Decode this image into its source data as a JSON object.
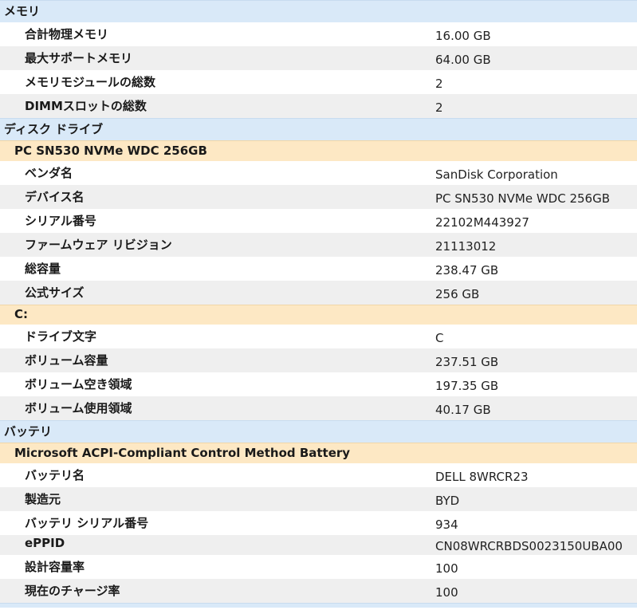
{
  "rows": [
    {
      "kind": "section",
      "label": "メモリ",
      "h": 28
    },
    {
      "kind": "item",
      "key": "合計物理メモリ",
      "value": "16.00 GB",
      "h": 30,
      "alt": false
    },
    {
      "kind": "item",
      "key": "最大サポートメモリ",
      "value": "64.00 GB",
      "h": 30,
      "alt": true
    },
    {
      "kind": "item",
      "key": "メモリモジュールの総数",
      "value": "2",
      "h": 30,
      "alt": false
    },
    {
      "kind": "item",
      "key": "DIMMスロットの総数",
      "value": "2",
      "h": 30,
      "alt": true
    },
    {
      "kind": "section",
      "label": "ディスク ドライブ",
      "h": 28
    },
    {
      "kind": "subsection",
      "label": "PC SN530 NVMe WDC 256GB",
      "h": 26
    },
    {
      "kind": "item",
      "key": "ベンダ名",
      "value": "SanDisk Corporation",
      "h": 30,
      "alt": false
    },
    {
      "kind": "item",
      "key": "デバイス名",
      "value": "PC SN530 NVMe WDC 256GB",
      "h": 30,
      "alt": true
    },
    {
      "kind": "item",
      "key": "シリアル番号",
      "value": "22102M443927",
      "h": 30,
      "alt": false
    },
    {
      "kind": "item",
      "key": "ファームウェア リビジョン",
      "value": "21113012",
      "h": 30,
      "alt": true
    },
    {
      "kind": "item",
      "key": "総容量",
      "value": "238.47 GB",
      "h": 30,
      "alt": false
    },
    {
      "kind": "item",
      "key": "公式サイズ",
      "value": "256 GB",
      "h": 30,
      "alt": true
    },
    {
      "kind": "subsection",
      "label": "C:",
      "h": 25
    },
    {
      "kind": "item",
      "key": "ドライブ文字",
      "value": "C",
      "h": 30,
      "alt": false
    },
    {
      "kind": "item",
      "key": "ボリューム容量",
      "value": "237.51 GB",
      "h": 30,
      "alt": true
    },
    {
      "kind": "item",
      "key": "ボリューム空き領域",
      "value": "197.35 GB",
      "h": 30,
      "alt": false
    },
    {
      "kind": "item",
      "key": "ボリューム使用領域",
      "value": "40.17 GB",
      "h": 30,
      "alt": true
    },
    {
      "kind": "section",
      "label": "バッテリ",
      "h": 28
    },
    {
      "kind": "subsection",
      "label": "Microsoft ACPI-Compliant Control Method Battery",
      "h": 26
    },
    {
      "kind": "item",
      "key": "バッテリ名",
      "value": "DELL 8WRCR23",
      "h": 30,
      "alt": false
    },
    {
      "kind": "item",
      "key": "製造元",
      "value": "BYD",
      "h": 30,
      "alt": true
    },
    {
      "kind": "item",
      "key": "バッテリ シリアル番号",
      "value": "934",
      "h": 30,
      "alt": false
    },
    {
      "kind": "item",
      "key": "ePPID",
      "value": "CN08WRCRBDS0023150UBA00",
      "h": 25,
      "alt": true
    },
    {
      "kind": "item",
      "key": "設計容量率",
      "value": "100",
      "h": 30,
      "alt": false
    },
    {
      "kind": "item",
      "key": "現在のチャージ率",
      "value": "100",
      "h": 30,
      "alt": true
    }
  ]
}
